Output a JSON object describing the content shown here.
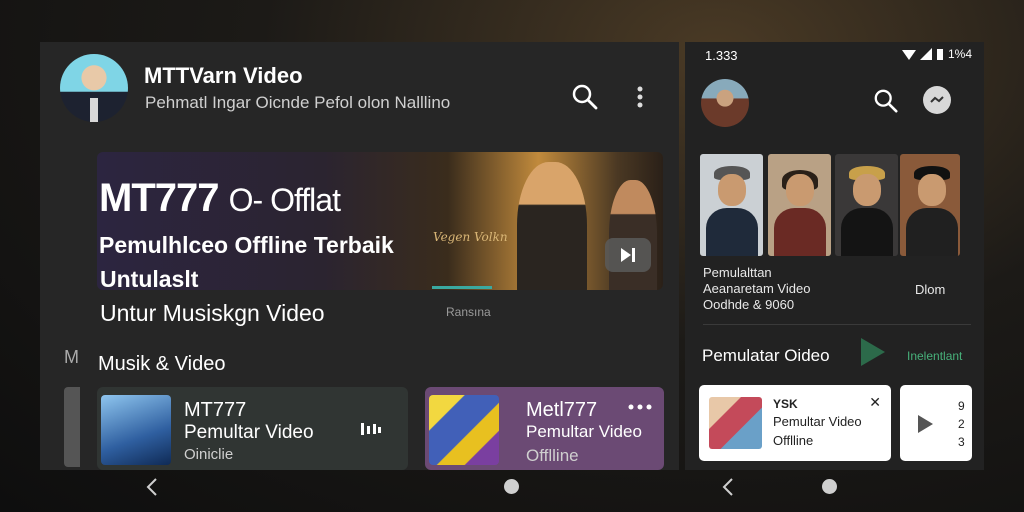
{
  "left": {
    "header": {
      "title": "MTTVarn Video",
      "subtitle": "Pehmatl Ingar Oicnde Pefol olon Nalllino"
    },
    "hero": {
      "title_bold": "MT777",
      "title_rest": "O- Offlat",
      "line1": "Pemulhlceo Offline Terbaik",
      "line2": "Untulaslt",
      "line3": "Untur Musiskgn Video",
      "signature": "Vegen Volkn",
      "caption": "Ransına"
    },
    "section_title": "Musik & Video",
    "edge_letter": "M",
    "cards": [
      {
        "title": "MT777",
        "subtitle": "Pemultar Video",
        "meta": "Oiniclie",
        "icon": "music-bars-icon"
      },
      {
        "title": "Metl777",
        "subtitle": "Pemultar Video",
        "meta": "Offlline",
        "icon": "more-dots-icon"
      }
    ]
  },
  "right": {
    "status": {
      "time": "1.333",
      "battery": "1%4"
    },
    "faces_caption": [
      "Pemulalttan",
      "Aeanaretam Video",
      "Oodhde  & 9060"
    ],
    "faces_side": "Dlom",
    "section_title": "Pemulatar Oideo",
    "section_link": "Inelentlant",
    "card": {
      "top": "YSK",
      "title": "Pemultar Video",
      "meta": "Offlline"
    },
    "card2_lines": [
      "9",
      "2",
      "3"
    ]
  },
  "colors": {
    "accent_teal": "#3aa9a0",
    "accent_green": "#47b07a",
    "panel_bg": "#262626"
  }
}
